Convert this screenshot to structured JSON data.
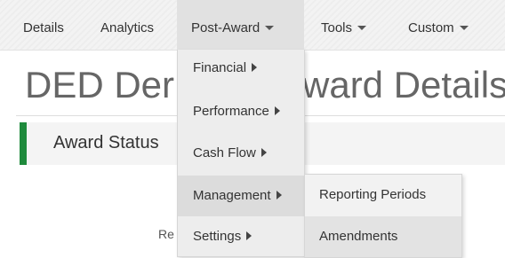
{
  "nav": {
    "items": [
      {
        "label": "Details"
      },
      {
        "label": "Analytics"
      },
      {
        "label": "Post-Award"
      },
      {
        "label": "Tools"
      },
      {
        "label": "Custom"
      }
    ]
  },
  "page": {
    "title_left": "DED Der",
    "title_right": "ward Details",
    "status_title": "Award Status",
    "partial_label": "Re"
  },
  "menu": {
    "items": [
      {
        "label": "Financial"
      },
      {
        "label": "Performance"
      },
      {
        "label": "Cash Flow"
      },
      {
        "label": "Management"
      },
      {
        "label": "Settings"
      }
    ]
  },
  "submenu": {
    "items": [
      {
        "label": "Reporting Periods"
      },
      {
        "label": "Amendments"
      }
    ]
  },
  "colors": {
    "accent_green": "#1e8a3c",
    "nav_bg": "#f3f3f3",
    "menu_bg": "#ededed"
  }
}
